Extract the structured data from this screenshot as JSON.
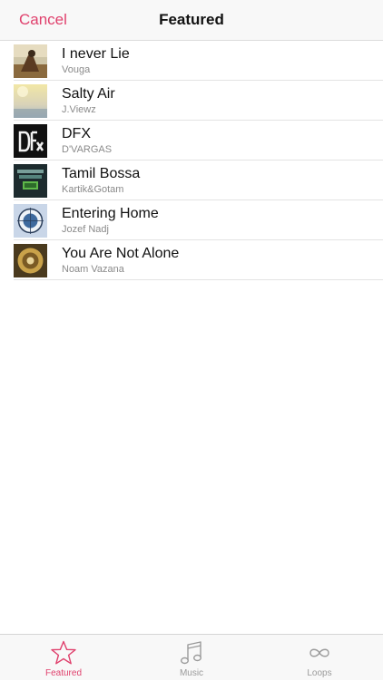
{
  "nav": {
    "cancel_label": "Cancel",
    "title": "Featured"
  },
  "tracks": [
    {
      "title": "I never Lie",
      "artist": "Vouga"
    },
    {
      "title": "Salty Air",
      "artist": "J.Viewz"
    },
    {
      "title": "DFX",
      "artist": "D'VARGAS"
    },
    {
      "title": "Tamil Bossa",
      "artist": "Kartik&Gotam"
    },
    {
      "title": "Entering Home",
      "artist": "Jozef Nadj"
    },
    {
      "title": "You Are Not Alone",
      "artist": "Noam Vazana"
    }
  ],
  "tabs": [
    {
      "label": "Featured",
      "icon": "star-icon"
    },
    {
      "label": "Music",
      "icon": "music-note-icon"
    },
    {
      "label": "Loops",
      "icon": "infinity-icon"
    }
  ],
  "colors": {
    "accent": "#e0416d",
    "inactive_tab": "#9a9a9a"
  },
  "selected_tab": "Featured"
}
